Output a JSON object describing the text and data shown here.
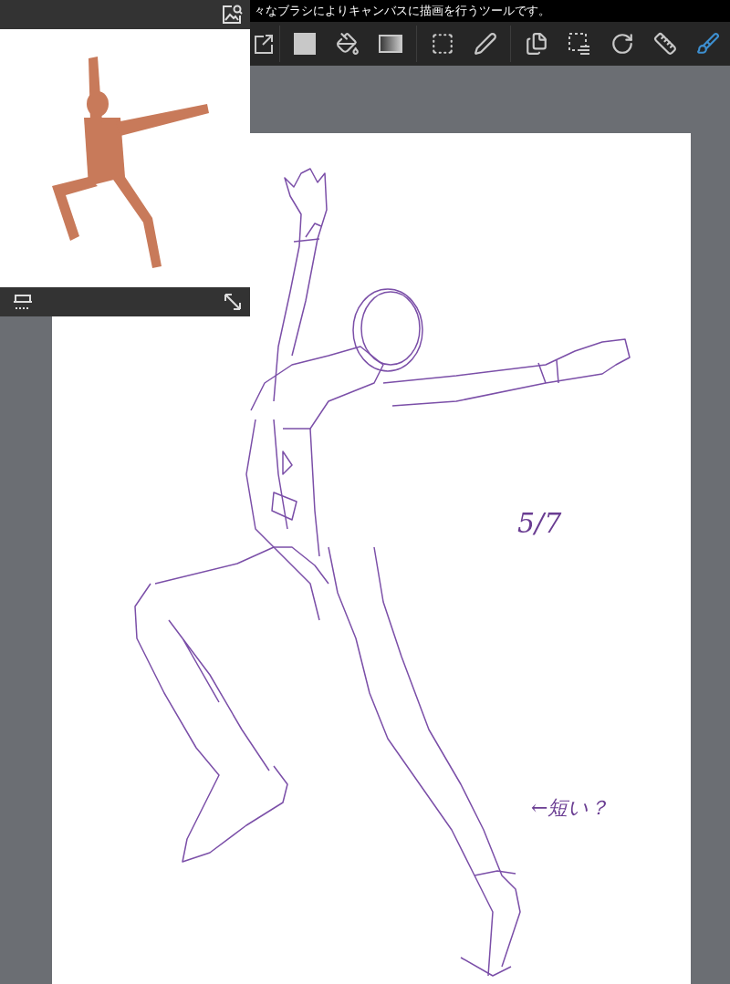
{
  "status_text": "々なブラシによりキャンバスに描画を行うツールです。",
  "toolbar": {
    "groups": [
      {
        "tools": [
          {
            "kind": "export",
            "selected": false
          }
        ]
      },
      {
        "tools": [
          {
            "kind": "color",
            "selected": false
          },
          {
            "kind": "bucket",
            "selected": false
          },
          {
            "kind": "gradient",
            "selected": false
          }
        ]
      },
      {
        "tools": [
          {
            "kind": "select",
            "selected": false
          },
          {
            "kind": "pen",
            "selected": false
          }
        ]
      },
      {
        "tools": [
          {
            "kind": "layers",
            "selected": false
          },
          {
            "kind": "selection-menu",
            "selected": false
          },
          {
            "kind": "rotate",
            "selected": false
          },
          {
            "kind": "ruler",
            "selected": false
          },
          {
            "kind": "brush",
            "selected": true
          }
        ]
      }
    ]
  },
  "canvas_notes": [
    {
      "text": "5/7"
    },
    {
      "text": "←短い？"
    }
  ]
}
